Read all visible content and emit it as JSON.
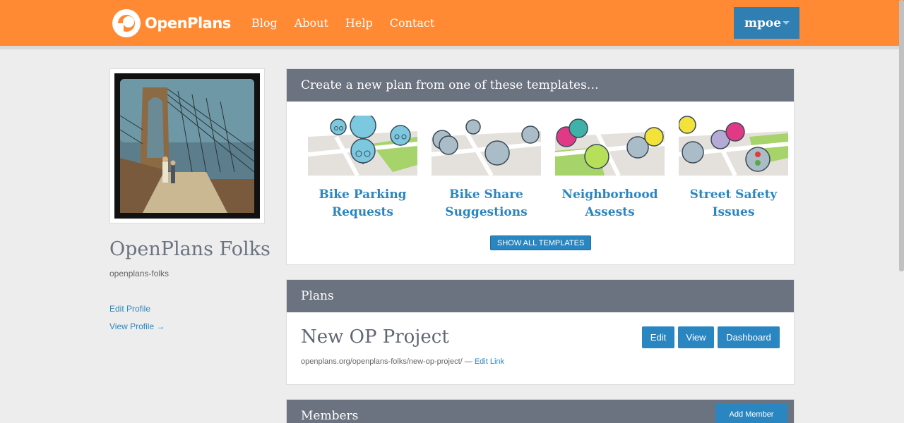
{
  "header": {
    "logo_text": "OpenPlans",
    "nav": [
      {
        "label": "Blog"
      },
      {
        "label": "About"
      },
      {
        "label": "Help"
      },
      {
        "label": "Contact"
      }
    ],
    "user_label": "mpoe"
  },
  "profile": {
    "name": "OpenPlans Folks",
    "slug": "openplans-folks",
    "edit_link": "Edit Profile",
    "view_link": "View Profile →"
  },
  "templates": {
    "heading": "Create a new plan from one of these templates…",
    "items": [
      {
        "line1": "Bike Parking",
        "line2": "Requests"
      },
      {
        "line1": "Bike Share",
        "line2": "Suggestions"
      },
      {
        "line1": "Neighborhood",
        "line2": "Assests"
      },
      {
        "line1": "Street Safety",
        "line2": "Issues"
      }
    ],
    "show_all": "SHOW ALL TEMPLATES"
  },
  "plans": {
    "heading": "Plans",
    "items": [
      {
        "title": "New OP Project",
        "url": "openplans.org/openplans-folks/new-op-project/",
        "separator": " — ",
        "edit_link": "Edit Link",
        "edit": "Edit",
        "view": "View",
        "dashboard": "Dashboard"
      }
    ]
  },
  "members": {
    "heading": "Members",
    "add": "Add Member"
  },
  "colors": {
    "header": "#ff8a33",
    "primary": "#2a86c1",
    "panel_header": "#6b7280",
    "background": "#ededed"
  }
}
